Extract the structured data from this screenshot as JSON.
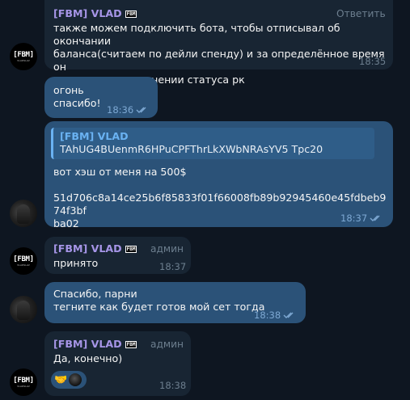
{
  "messages": [
    {
      "sender": "[FBM] VLAD",
      "badge": "FBM",
      "action": "Ответить",
      "text": "также можем подключить бота, чтобы отписывал об окончании\nбаланса(считаем по дейли спенду) и за определённое время он\nпишет в чат, изменении статуса рк",
      "time": "18:35"
    },
    {
      "text": "огонь\nспасибо!",
      "time": "18:36"
    },
    {
      "reply_name": "[FBM] VLAD",
      "reply_text": "TAhUG4BUenmR6HPuCPFThrLkXWbNRAsYV5  Tpc20",
      "text": "вот хэш от меня на 500$\n\n51d706c8a14ce25b6f85833f01f66008fb89b92945460e45fdbeb974f3bf\nba02",
      "time": "18:37"
    },
    {
      "sender": "[FBM] VLAD",
      "badge": "FBM",
      "role": "админ",
      "text": "принято",
      "time": "18:37"
    },
    {
      "text": "Спасибо, парни\nтегните как будет готов мой сет тогда",
      "time": "18:38"
    },
    {
      "sender": "[FBM] VLAD",
      "badge": "FBM",
      "role": "админ",
      "text": "Да, конечно)",
      "reaction": "🤝",
      "time": "18:38"
    }
  ],
  "avatar_text": {
    "logo": "[FBM]",
    "sub": "VLADSLAV"
  },
  "colors": {
    "background": "#0e1621",
    "incoming": "#182533",
    "outgoing": "#2b5278",
    "sender": "#a695e7",
    "accent": "#6ab2f2"
  }
}
